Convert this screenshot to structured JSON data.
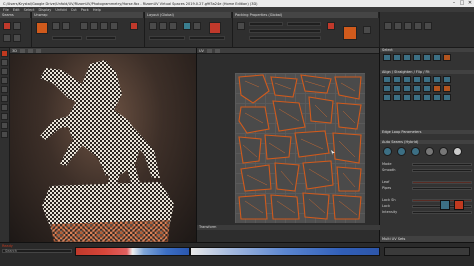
{
  "window": {
    "title": "C:/Users/Krystal/Google Drive/Unfold/UV/RizomUV/Photogrammetry/Horse.fbx - RizomUV Virtual Spaces 2019.0.27.g9f3a24e (Home Edition) (3D)",
    "minimize": "–",
    "maximize": "□",
    "close": "✕"
  },
  "menu": [
    "File",
    "Edit",
    "Select",
    "Display",
    "Unfold",
    "Cut",
    "Pack",
    "Help"
  ],
  "toolbar": {
    "groups": [
      {
        "label": "Seams"
      },
      {
        "label": "Unwrap"
      },
      {
        "label": "Layout (Global)"
      },
      {
        "label": "Packing Properties (Global)"
      }
    ]
  },
  "viewport_3d": {
    "header": "3D"
  },
  "viewport_uv": {
    "header": "UV",
    "transform_label": "Transform"
  },
  "right_panel": {
    "select_label": "Select",
    "align_label": "Align / Straighten / Flip / Fit",
    "edge_loop_label": "Edge Loop Parameters",
    "auto_seams_label": "Auto Seams (Hybrid)",
    "fields": [
      {
        "label": "Mode"
      },
      {
        "label": "Smooth"
      },
      {
        "label": "Leaf"
      },
      {
        "label": "Pipes"
      },
      {
        "label": "Lock Sh"
      },
      {
        "label": "Lock"
      },
      {
        "label": "Intensity"
      }
    ],
    "multi_uv_label": "Multi UV Sets"
  },
  "bottom": {
    "search_placeholder": "Search",
    "status": "Ready"
  },
  "colors": {
    "accent": "#c0392b",
    "uv_wire": "#d05a1c",
    "panel": "#333333"
  }
}
